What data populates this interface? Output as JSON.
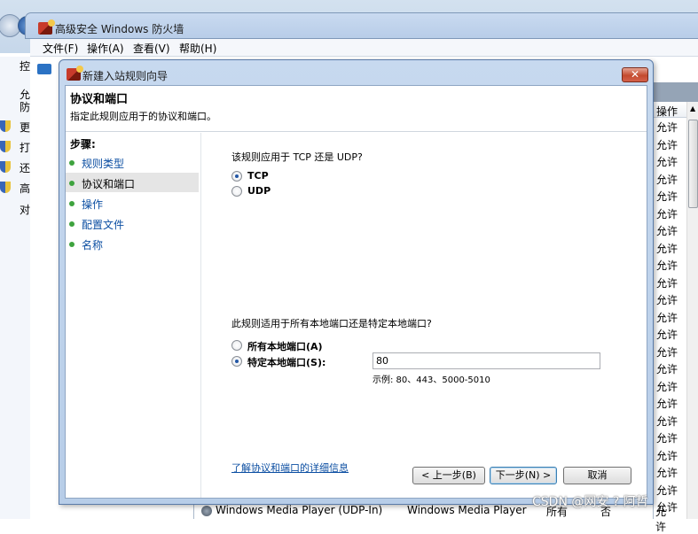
{
  "main_window": {
    "title": "高级安全 Windows 防火墙",
    "menu": [
      "文件(F)",
      "操作(A)",
      "查看(V)",
      "帮助(H)"
    ],
    "left_panel_fragments": [
      "控",
      "允",
      "防",
      "更",
      "打",
      "还",
      "高",
      "对"
    ],
    "right_panel": {
      "column_header": "操作",
      "rows": [
        "允许",
        "允许",
        "允许",
        "允许",
        "允许",
        "允许",
        "允许",
        "允许",
        "允许",
        "允许",
        "允许",
        "允许",
        "允许",
        "允许",
        "允许",
        "允许",
        "允许",
        "允许",
        "允许",
        "允许",
        "允许",
        "允许",
        "允许"
      ]
    },
    "bottom_row": {
      "name": "Windows Media Player (UDP-In)",
      "group": "Windows Media Player",
      "profile": "所有",
      "enabled": "否",
      "action": "允许"
    }
  },
  "dialog": {
    "title": "新建入站规则向导",
    "close_label": "✕",
    "heading": "协议和端口",
    "subheading": "指定此规则应用于的协议和端口。",
    "steps_title": "步骤:",
    "steps": [
      {
        "label": "规则类型",
        "current": false
      },
      {
        "label": "协议和端口",
        "current": true
      },
      {
        "label": "操作",
        "current": false
      },
      {
        "label": "配置文件",
        "current": false
      },
      {
        "label": "名称",
        "current": false
      }
    ],
    "protocol_question": "该规则应用于 TCP 还是 UDP?",
    "protocol_options": [
      {
        "label": "TCP",
        "checked": true
      },
      {
        "label": "UDP",
        "checked": false
      }
    ],
    "port_question": "此规则适用于所有本地端口还是特定本地端口?",
    "port_options": [
      {
        "label": "所有本地端口(A)",
        "checked": false
      },
      {
        "label": "特定本地端口(S):",
        "checked": true
      }
    ],
    "port_value": "80",
    "port_example": "示例: 80、443、5000-5010",
    "help_link": "了解协议和端口的详细信息",
    "buttons": {
      "back": "< 上一步(B)",
      "next": "下一步(N) >",
      "cancel": "取消"
    }
  },
  "watermark": "CSDN @网安 ? 阿哲"
}
